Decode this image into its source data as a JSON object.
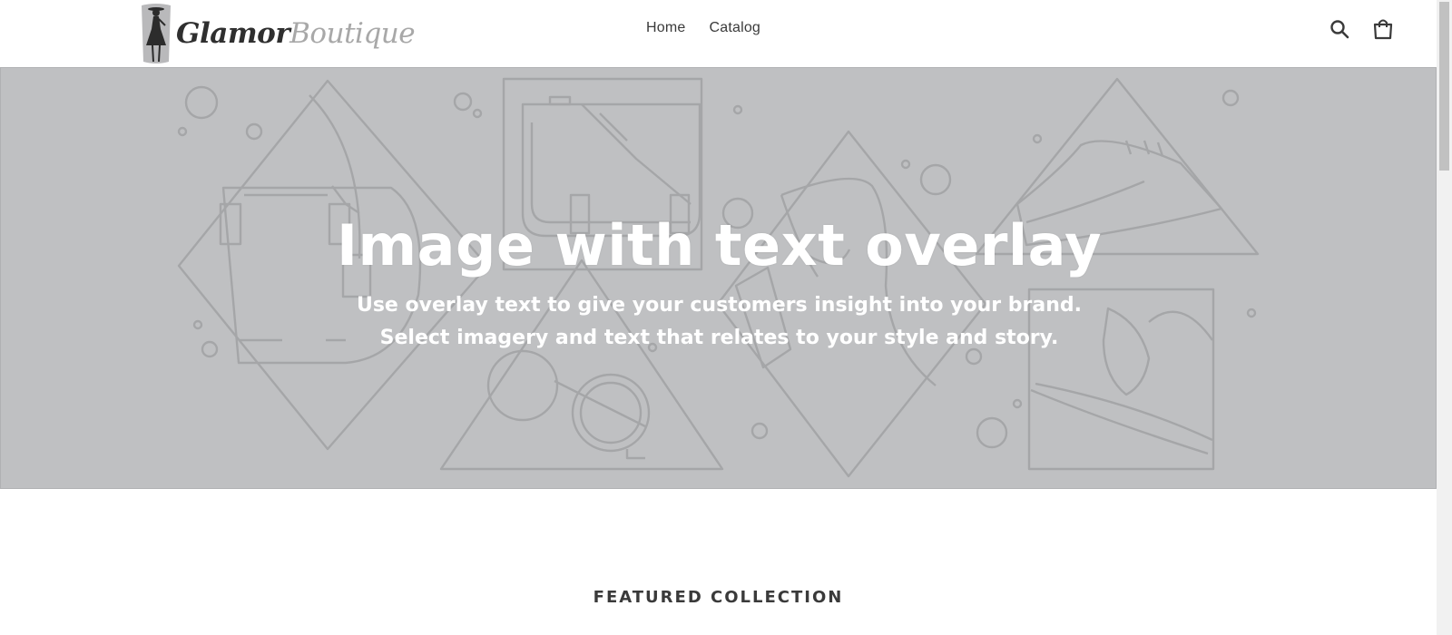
{
  "header": {
    "logo": {
      "word1": "Glamor",
      "word2": "Boutique"
    },
    "nav": [
      {
        "label": "Home"
      },
      {
        "label": "Catalog"
      }
    ],
    "icons": {
      "search": "search-icon",
      "cart": "cart-icon"
    }
  },
  "hero": {
    "title": "Image with text overlay",
    "subtitle_line1": "Use overlay text to give your customers insight into your brand.",
    "subtitle_line2": "Select imagery and text that relates to your style and story.",
    "background_color": "#bfc0c2",
    "line_color": "#a3a4a6"
  },
  "featured": {
    "title": "FEATURED COLLECTION"
  }
}
